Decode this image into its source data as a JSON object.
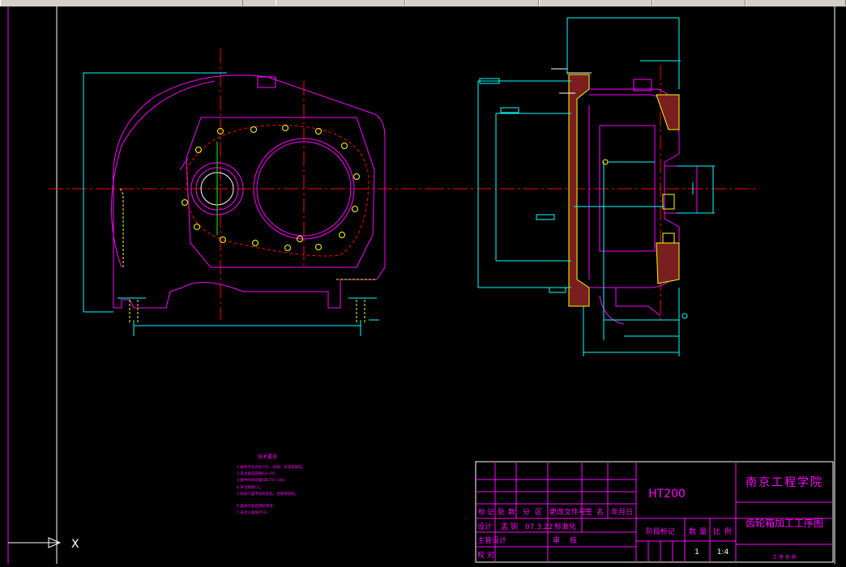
{
  "toolbar": {
    "fields": [
      "",
      "",
      "",
      "",
      "",
      ""
    ]
  },
  "title_block": {
    "school": "南京工程学院",
    "drawing_title": "齿轮箱加工工序图",
    "material": "HT200",
    "row1": [
      "标",
      "记",
      "处",
      "数",
      "分",
      "区",
      "更改文件号",
      "签",
      "名",
      "年月日"
    ],
    "row2_label": "设计",
    "row2_name": "孟",
    "row2_name2": "铜",
    "row2_date": "07.3.22",
    "row2_std": "标准化",
    "row3_label": "主管设计",
    "row3_review": "审",
    "row3_review2": "核",
    "row4_label": "校",
    "row4_label2": "对",
    "stage_label": "阶段标记",
    "qty_label": "数",
    "qty_label2": "量",
    "scale_label": "比",
    "scale_label2": "例",
    "qty_value": "1",
    "scale_value": "1:4",
    "footer": "工 序 名 称"
  },
  "notes": {
    "title": "技术要求",
    "lines": [
      "1.铸件不允许有气孔、砂眼、夹渣等缺陷。",
      "2.未注铸造圆角R3~R5。",
      "3.铸件时效处理HB170~240。",
      "4.未注倒角C1。",
      "5.各加工面不得有划伤、毛刺等缺陷。",
      "6.箱体内表面涂防锈漆。",
      "7.未注公差按IT14。"
    ]
  },
  "ucs": {
    "x_label": "X"
  }
}
